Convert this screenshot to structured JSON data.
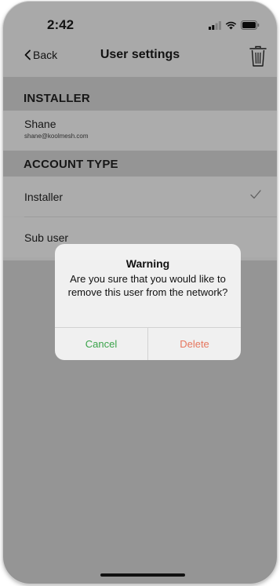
{
  "status_bar": {
    "time": "2:42"
  },
  "nav": {
    "back_label": "Back",
    "title": "User settings"
  },
  "installer_section": {
    "header": "INSTALLER",
    "name": "Shane",
    "email": "shane@koolmesh.com"
  },
  "account_type": {
    "header": "ACCOUNT TYPE",
    "options": [
      {
        "label": "Installer",
        "selected": true
      },
      {
        "label": "Sub user",
        "selected": false
      }
    ]
  },
  "dialog": {
    "title": "Warning",
    "message": "Are you sure that you would like to remove this user from the network?",
    "cancel_label": "Cancel",
    "delete_label": "Delete"
  },
  "colors": {
    "cancel": "#3aa34a",
    "delete": "#e6765e",
    "header_bg": "#d6d6d6"
  },
  "icons": [
    "signal-icon",
    "wifi-icon",
    "battery-icon",
    "chevron-left-icon",
    "trash-icon",
    "checkmark-icon"
  ]
}
